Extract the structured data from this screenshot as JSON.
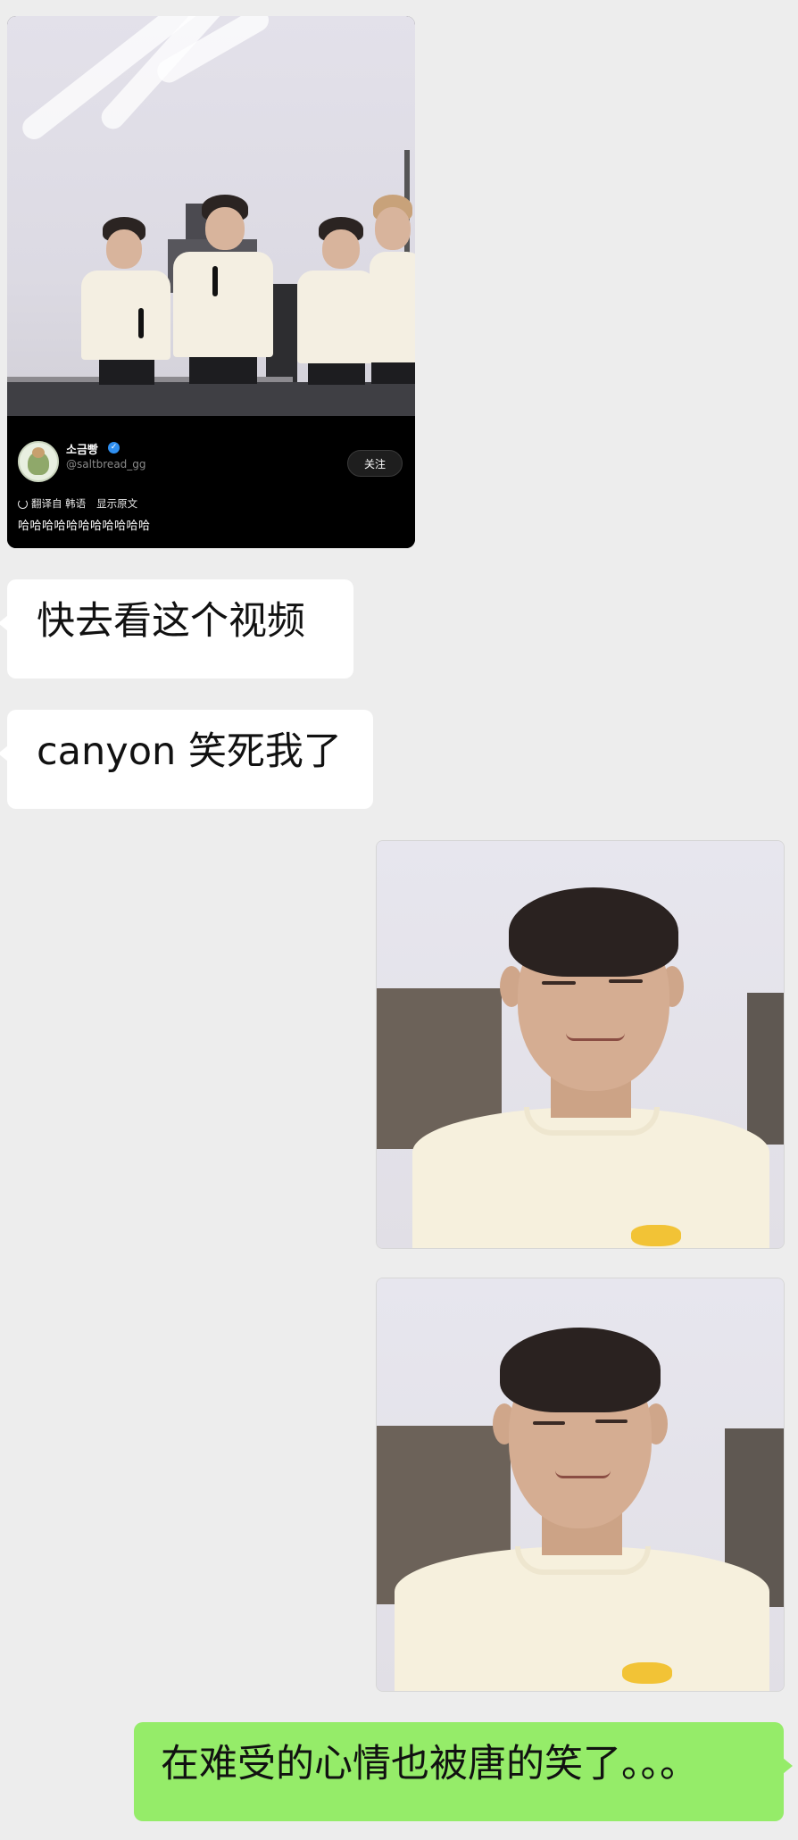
{
  "shared_video": {
    "author_name": "소금빵",
    "author_handle": "@saltbread_gg",
    "follow_label": "关注",
    "translated_from": "翻译自 韩语",
    "show_original_label": "显示原文",
    "caption": "哈哈哈哈哈哈哈哈哈哈哈"
  },
  "messages": [
    {
      "side": "left",
      "text": "快去看这个视频"
    },
    {
      "side": "left",
      "text": "canyon 笑死我了"
    },
    {
      "side": "right",
      "text": "在难受的心情也被唐的笑了。。。"
    }
  ],
  "colors": {
    "chat_background": "#ededed",
    "incoming_bubble": "#ffffff",
    "outgoing_bubble": "#95ec69",
    "verified_badge": "#2f8ff0"
  },
  "icons": {
    "verified": "verified-badge-icon",
    "translate": "refresh-icon"
  }
}
